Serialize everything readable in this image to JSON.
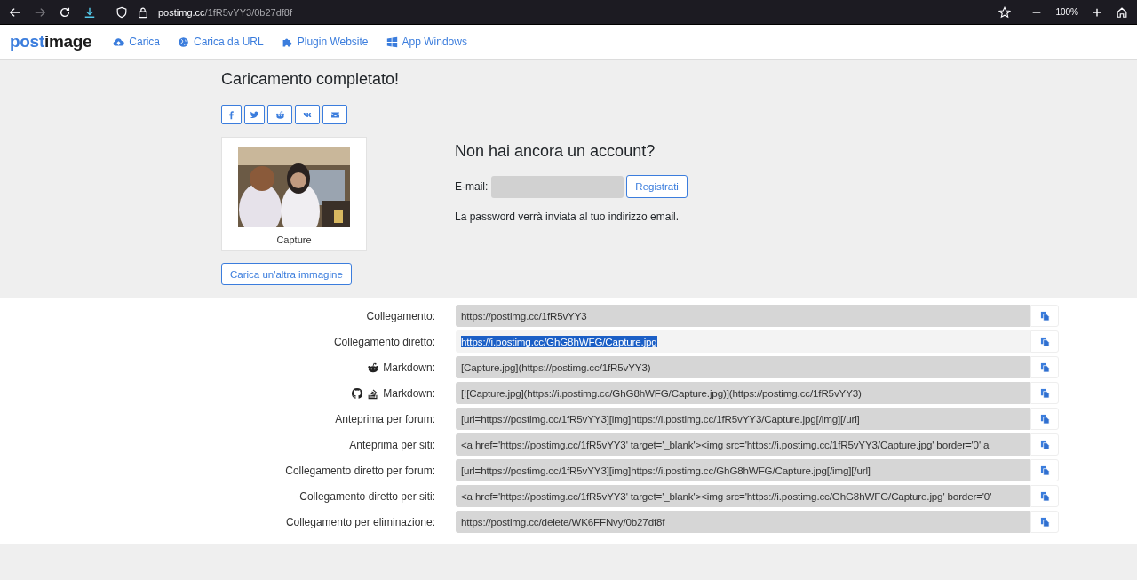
{
  "browser": {
    "url_host": "postimg.cc",
    "url_path": "/1fR5vYY3/0b27df8f",
    "zoom": "100%"
  },
  "nav": {
    "logo_left": "post",
    "logo_right": "image",
    "links": [
      {
        "label": "Carica"
      },
      {
        "label": "Carica da URL"
      },
      {
        "label": "Plugin Website"
      },
      {
        "label": "App Windows"
      }
    ]
  },
  "title": "Caricamento completato!",
  "thumbnail": {
    "kind": "picture",
    "caption": "Capture"
  },
  "upload_another": "Carica un'altra immagine",
  "signup": {
    "heading": "Non hai ancora un account?",
    "email_label": "E-mail:",
    "button": "Registrati",
    "note": "La password verrà inviata al tuo indirizzo email."
  },
  "links": [
    {
      "label": "Collegamento:",
      "kind": "plain",
      "value": "https://postimg.cc/1fR5vYY3",
      "selected": false
    },
    {
      "label": "Collegamento diretto:",
      "kind": "plain",
      "value": "https://i.postimg.cc/GhG8hWFG/Capture.jpg",
      "selected": true
    },
    {
      "label": "Markdown:",
      "kind": "reddit",
      "value": "[Capture.jpg](https://postimg.cc/1fR5vYY3)",
      "selected": false
    },
    {
      "label": "Markdown:",
      "kind": "github",
      "value": "[![Capture.jpg](https://i.postimg.cc/GhG8hWFG/Capture.jpg)](https://postimg.cc/1fR5vYY3)",
      "selected": false
    },
    {
      "label": "Anteprima per forum:",
      "kind": "plain",
      "value": "[url=https://postimg.cc/1fR5vYY3][img]https://i.postimg.cc/1fR5vYY3/Capture.jpg[/img][/url]",
      "selected": false
    },
    {
      "label": "Anteprima per siti:",
      "kind": "plain",
      "value": "<a href='https://postimg.cc/1fR5vYY3' target='_blank'><img src='https://i.postimg.cc/1fR5vYY3/Capture.jpg' border='0' a",
      "selected": false
    },
    {
      "label": "Collegamento diretto per forum:",
      "kind": "plain",
      "value": "[url=https://postimg.cc/1fR5vYY3][img]https://i.postimg.cc/GhG8hWFG/Capture.jpg[/img][/url]",
      "selected": false
    },
    {
      "label": "Collegamento diretto per siti:",
      "kind": "plain",
      "value": "<a href='https://postimg.cc/1fR5vYY3' target='_blank'><img src='https://i.postimg.cc/GhG8hWFG/Capture.jpg' border='0'",
      "selected": false
    },
    {
      "label": "Collegamento per eliminazione:",
      "kind": "plain",
      "value": "https://postimg.cc/delete/WK6FFNvy/0b27df8f",
      "selected": false
    }
  ]
}
